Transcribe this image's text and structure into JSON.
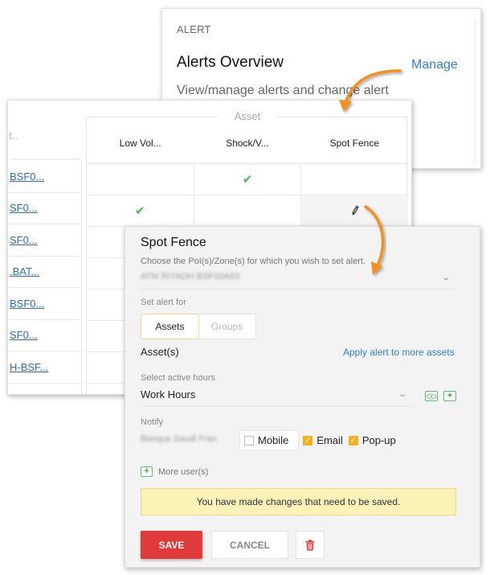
{
  "overview": {
    "kicker": "ALERT",
    "title": "Alerts Overview",
    "manage_link": "Manage",
    "description": "View/manage alerts and change alert"
  },
  "table": {
    "left_column_header": "et..",
    "group_label": "Asset",
    "columns": [
      "Low Vol...",
      "Shock/V...",
      "Spot Fence"
    ],
    "rows": [
      {
        "asset": "BSF0...",
        "cells": [
          "",
          "check",
          ""
        ]
      },
      {
        "asset": "SF0...",
        "cells": [
          "check",
          "",
          "edit"
        ]
      },
      {
        "asset": "SF0...",
        "cells": [
          "",
          "",
          ""
        ]
      },
      {
        "asset": ".BAT...",
        "cells": [
          "",
          "",
          ""
        ]
      },
      {
        "asset": "BSF0...",
        "cells": [
          "",
          "",
          ""
        ]
      },
      {
        "asset": "SF0...",
        "cells": [
          "",
          "",
          ""
        ]
      },
      {
        "asset": "H-BSF...",
        "cells": [
          "",
          "",
          ""
        ]
      },
      {
        "asset": "",
        "cells": [
          "",
          "",
          ""
        ]
      }
    ],
    "check_glyph": "✔",
    "edit_icon": "pencil-icon"
  },
  "form": {
    "title": "Spot Fence",
    "poi_label": "Choose the PoI(s)/Zone(s) for which you wish to set alert.",
    "poi_value_blurred": "ATM RIYADH-BSF00A83",
    "set_alert_for_label": "Set alert for",
    "segments": [
      {
        "label": "Assets",
        "selected": true
      },
      {
        "label": "Groups",
        "selected": false
      }
    ],
    "assets_heading": "Asset(s)",
    "apply_more_link": "Apply alert to more assets",
    "active_hours_label": "Select active hours",
    "active_hours_value": "Work Hours",
    "view_hours_icon": "eye-icon",
    "add_hours_icon": "plus-icon",
    "notify_label": "Notify",
    "notify_user_blurred": "Banque Saudi Fran",
    "channels": [
      {
        "label": "Mobile",
        "checked": false
      },
      {
        "label": "Email",
        "checked": true
      },
      {
        "label": "Pop-up",
        "checked": true
      }
    ],
    "more_users_label": "More user(s)",
    "notice": "You have made changes that need to be saved.",
    "save_label": "SAVE",
    "cancel_label": "CANCEL",
    "delete_icon": "trash-icon"
  },
  "colors": {
    "accent_blue": "#2f7fe0",
    "save_red": "#e03a3a",
    "check_green": "#4cbb4c",
    "checkbox_orange": "#f5b21f",
    "notice_bg": "#fbf2b8",
    "arrow_orange": "#f5901e"
  }
}
